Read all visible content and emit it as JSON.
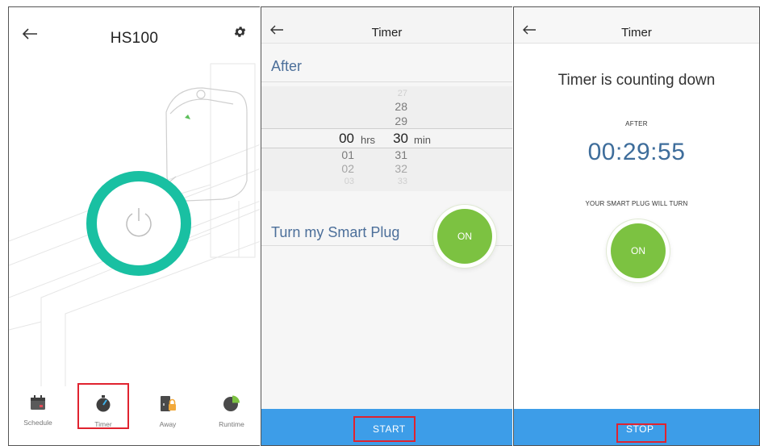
{
  "panel1": {
    "title": "HS100",
    "tabs": [
      {
        "label": "Schedule",
        "icon": "calendar-icon"
      },
      {
        "label": "Timer",
        "icon": "stopwatch-icon"
      },
      {
        "label": "Away",
        "icon": "away-lock-icon"
      },
      {
        "label": "Runtime",
        "icon": "pie-chart-icon"
      }
    ],
    "accent_color": "#19c0a2"
  },
  "panel2": {
    "title": "Timer",
    "after_label": "After",
    "picker": {
      "hours_above": [
        "",
        ""
      ],
      "hours_selected": "00",
      "hours_below": [
        "01",
        "02",
        "03"
      ],
      "hours_unit": "hrs",
      "minutes_above": [
        "27",
        "28",
        "29"
      ],
      "minutes_selected": "30",
      "minutes_below": [
        "31",
        "32",
        "33"
      ],
      "minutes_unit": "min"
    },
    "turn_label": "Turn my Smart Plug",
    "on_label": "ON",
    "start_label": "START"
  },
  "panel3": {
    "title": "Timer",
    "counting_text": "Timer is counting down",
    "after_text": "AFTER",
    "countdown": "00:29:55",
    "turn_text": "YOUR SMART PLUG WILL TURN",
    "on_label": "ON",
    "stop_label": "STOP"
  },
  "colors": {
    "primary_blue": "#3d9de8",
    "on_green": "#7cc241",
    "highlight_red": "#e0232f",
    "label_blue": "#4c6f9a"
  }
}
